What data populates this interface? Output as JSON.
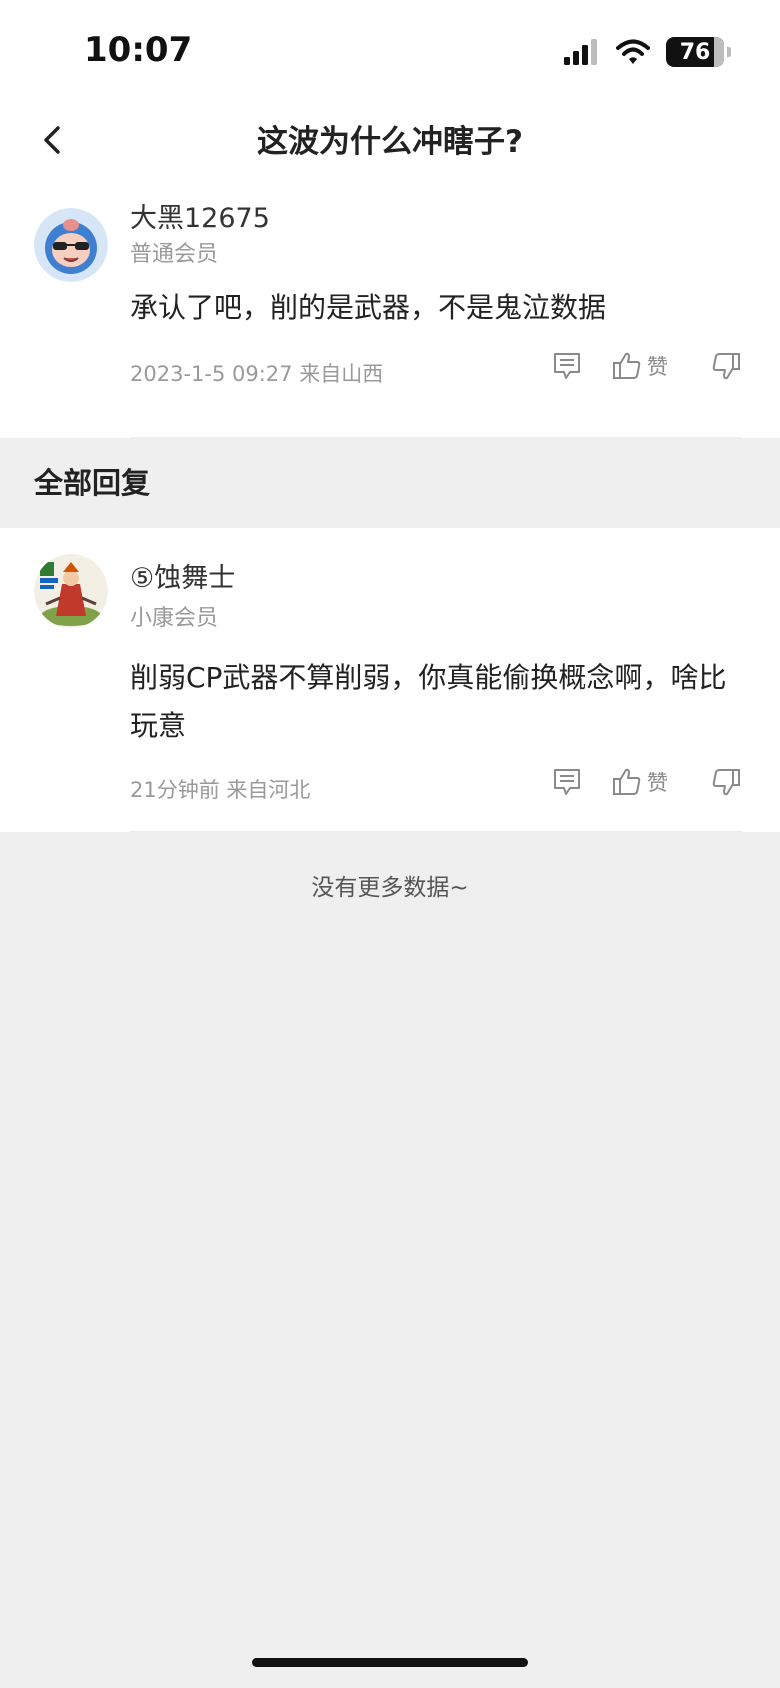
{
  "status_bar": {
    "time": "10:07",
    "battery": "76"
  },
  "nav": {
    "title": "这波为什么冲瞎子?"
  },
  "main_comment": {
    "username": "大黑12675",
    "member_level": "普通会员",
    "body": "承认了吧，削的是武器，不是鬼泣数据",
    "meta": "2023-1-5 09:27  来自山西",
    "like_label": "赞"
  },
  "section_header": "全部回复",
  "reply": {
    "username": "⑤蚀舞士",
    "member_level": "小康会员",
    "body": "削弱CP武器不算削弱，你真能偷换概念啊，啥比玩意",
    "meta": "21分钟前 来自河北",
    "like_label": "赞"
  },
  "footer": {
    "no_more": "没有更多数据~"
  },
  "colors": {
    "page_bg": "#efefef",
    "card_bg": "#ffffff",
    "muted_text": "#9a9a9a",
    "icon_stroke": "#8a8a8a"
  }
}
